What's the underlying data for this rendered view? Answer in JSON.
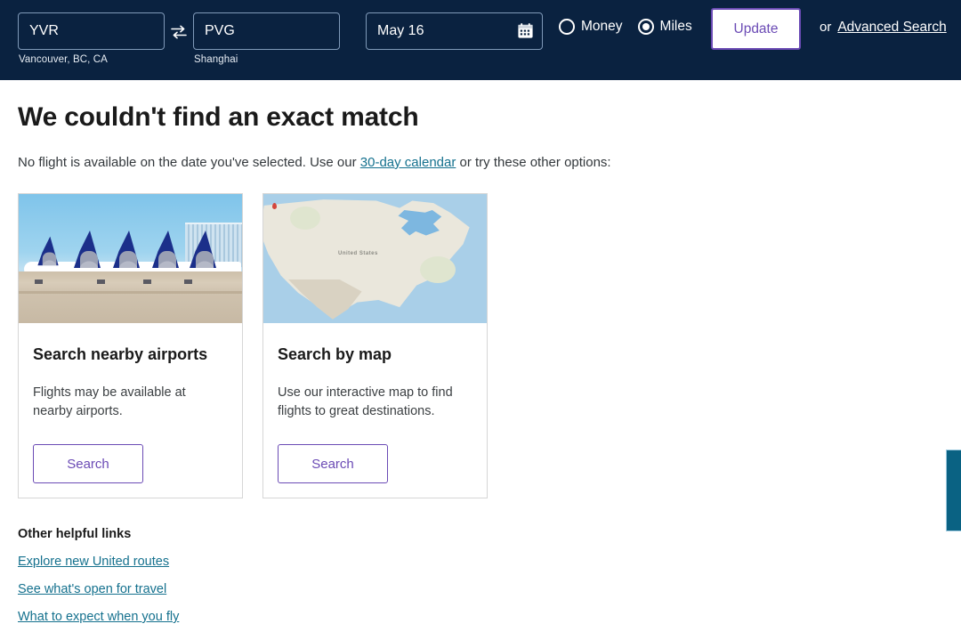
{
  "search_header": {
    "origin": {
      "value": "YVR",
      "placeholder": "From",
      "sublabel": "Vancouver, BC, CA"
    },
    "swap_icon": "swap-arrows-icon",
    "destination": {
      "value": "PVG",
      "placeholder": "To",
      "sublabel": "Shanghai"
    },
    "date": {
      "value": "May 16",
      "placeholder": "Depart",
      "icon": "calendar-icon"
    },
    "fare_types": [
      {
        "label": "Money",
        "selected": false
      },
      {
        "label": "Miles",
        "selected": true
      }
    ],
    "update_label": "Update",
    "or_text": "or",
    "advanced_search_label": "Advanced Search",
    "colors": {
      "background": "#0a2240",
      "accent_purple": "#6b4bb5",
      "field_border": "#7f99b8"
    }
  },
  "main": {
    "title": "We couldn't find an exact match",
    "subtitle_before": "No flight is available on the date you've selected. Use our ",
    "subtitle_link": "30-day calendar",
    "subtitle_after": " or try these other options:",
    "cards": [
      {
        "image": "united-airplanes-at-gate-photo",
        "title": "Search nearby airports",
        "description": "Flights may be available at nearby airports.",
        "button_label": "Search"
      },
      {
        "image": "united-states-map-thumbnail",
        "map_label": "United States",
        "title": "Search by map",
        "description": "Use our interactive map to find flights to great destinations.",
        "button_label": "Search"
      }
    ],
    "helpful_links": {
      "title": "Other helpful links",
      "items": [
        "Explore new United routes",
        "See what's open for travel",
        "What to expect when you fly"
      ]
    },
    "link_color": "#15718e"
  },
  "feedback_tab": {
    "name": "feedback-tab",
    "color": "#0a6283"
  }
}
